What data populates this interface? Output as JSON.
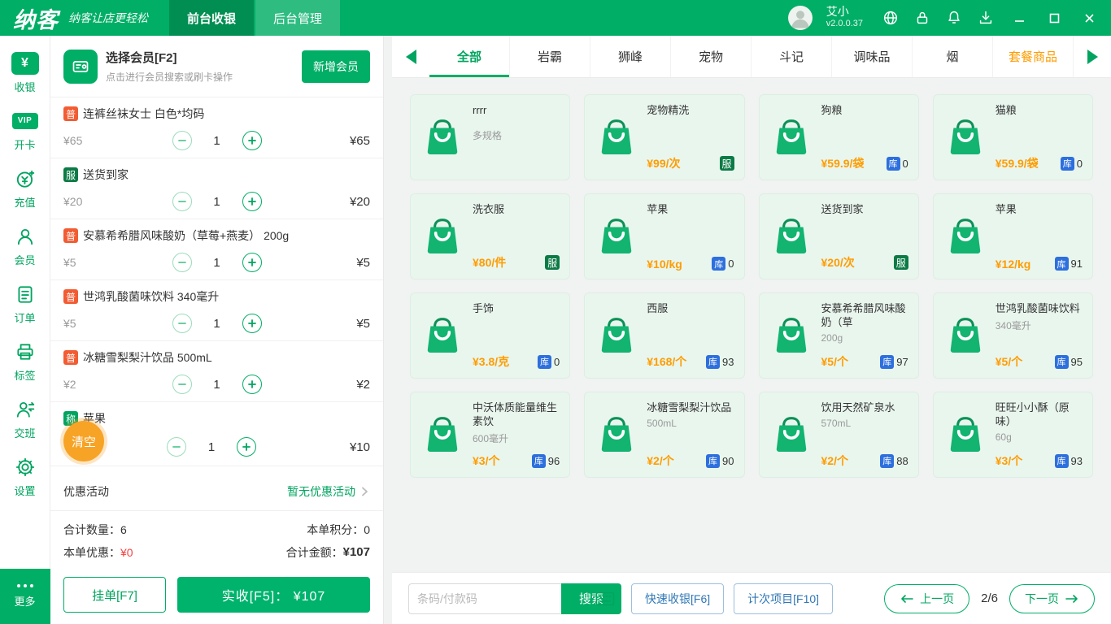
{
  "colors": {
    "primary": "#00ae66",
    "price_orange": "#ff9c00",
    "stock_blue": "#2d6fdd",
    "service_green": "#0c7a45",
    "normal_badge": "#f25c33",
    "clear_orange": "#f7a326",
    "discount_red": "#f53f3f"
  },
  "topbar": {
    "logo": "纳客",
    "slogan": "纳客让店更轻松",
    "tabs": [
      {
        "label": "前台收银"
      },
      {
        "label": "后台管理"
      }
    ],
    "user_name": "艾小",
    "version": "v2.0.0.37"
  },
  "sidebar": {
    "items": [
      {
        "label": "收银"
      },
      {
        "label": "开卡"
      },
      {
        "label": "充值"
      },
      {
        "label": "会员"
      },
      {
        "label": "订单"
      },
      {
        "label": "标签"
      },
      {
        "label": "交班"
      },
      {
        "label": "设置"
      },
      {
        "label": "更多"
      }
    ]
  },
  "member": {
    "title": "选择会员[F2]",
    "subtitle": "点击进行会员搜索或刷卡操作",
    "add_button": "新增会员"
  },
  "cart": {
    "items": [
      {
        "badge": "普",
        "name": "连裤丝袜女士 白色*均码",
        "unit_price": "¥65",
        "qty": "1",
        "total": "¥65"
      },
      {
        "badge": "服",
        "name": "送货到家",
        "unit_price": "¥20",
        "qty": "1",
        "total": "¥20"
      },
      {
        "badge": "普",
        "name": "安慕希希腊风味酸奶（草莓+燕麦） 200g",
        "unit_price": "¥5",
        "qty": "1",
        "total": "¥5"
      },
      {
        "badge": "普",
        "name": "世鸿乳酸菌味饮料 340毫升",
        "unit_price": "¥5",
        "qty": "1",
        "total": "¥5"
      },
      {
        "badge": "普",
        "name": "冰糖雪梨梨汁饮品 500mL",
        "unit_price": "¥2",
        "qty": "1",
        "total": "¥2"
      },
      {
        "badge": "称",
        "name": "苹果",
        "unit_price": "",
        "qty": "1",
        "total": "¥10"
      }
    ],
    "clear_button": "清空",
    "promo_label": "优惠活动",
    "promo_value": "暂无优惠活动",
    "summary": {
      "qty_label": "合计数量：",
      "qty": "6",
      "points_label": "本单积分：",
      "points": "0",
      "discount_label": "本单优惠：",
      "discount": "¥0",
      "total_label": "合计金额：",
      "total": "¥107"
    },
    "hold_button": "挂单[F7]",
    "pay_button": "实收[F5]：  ¥107"
  },
  "categories": [
    {
      "label": "全部"
    },
    {
      "label": "岩霸"
    },
    {
      "label": "狮峰"
    },
    {
      "label": "宠物"
    },
    {
      "label": "斗记"
    },
    {
      "label": "调味品"
    },
    {
      "label": "烟"
    },
    {
      "label": "套餐商品"
    }
  ],
  "labels": {
    "stock_char": "库"
  },
  "products": [
    {
      "name": "rrrr",
      "sub": "多规格",
      "price": "",
      "tag": "",
      "stock": ""
    },
    {
      "name": "宠物精洗",
      "sub": "",
      "price": "¥99/次",
      "tag": "服",
      "stock": ""
    },
    {
      "name": "狗粮",
      "sub": "",
      "price": "¥59.9/袋",
      "tag": "",
      "stock": "0"
    },
    {
      "name": "猫粮",
      "sub": "",
      "price": "¥59.9/袋",
      "tag": "",
      "stock": "0"
    },
    {
      "name": "洗衣服",
      "sub": "",
      "price": "¥80/件",
      "tag": "服",
      "stock": ""
    },
    {
      "name": "苹果",
      "sub": "",
      "price": "¥10/kg",
      "tag": "",
      "stock": "0"
    },
    {
      "name": "送货到家",
      "sub": "",
      "price": "¥20/次",
      "tag": "服",
      "stock": ""
    },
    {
      "name": "苹果",
      "sub": "",
      "price": "¥12/kg",
      "tag": "",
      "stock": "91"
    },
    {
      "name": "手饰",
      "sub": "",
      "price": "¥3.8/克",
      "tag": "",
      "stock": "0"
    },
    {
      "name": "西服",
      "sub": "",
      "price": "¥168/个",
      "tag": "",
      "stock": "93"
    },
    {
      "name": "安慕希希腊风味酸奶（草",
      "sub": "200g",
      "price": "¥5/个",
      "tag": "",
      "stock": "97"
    },
    {
      "name": "世鸿乳酸菌味饮料",
      "sub": "340毫升",
      "price": "¥5/个",
      "tag": "",
      "stock": "95"
    },
    {
      "name": "中沃体质能量维生素饮",
      "sub": "600毫升",
      "price": "¥3/个",
      "tag": "",
      "stock": "96"
    },
    {
      "name": "冰糖雪梨梨汁饮品",
      "sub": "500mL",
      "price": "¥2/个",
      "tag": "",
      "stock": "90"
    },
    {
      "name": "饮用天然矿泉水",
      "sub": "570mL",
      "price": "¥2/个",
      "tag": "",
      "stock": "88"
    },
    {
      "name": "旺旺小小酥（原味）",
      "sub": "60g",
      "price": "¥3/个",
      "tag": "",
      "stock": "93"
    }
  ],
  "bottombar": {
    "search_placeholder": "条码/付款码",
    "search_button": "搜索",
    "quick_button": "快速收银[F6]",
    "count_button": "计次项目[F10]",
    "prev": "上一页",
    "page": "2/6",
    "next": "下一页"
  }
}
